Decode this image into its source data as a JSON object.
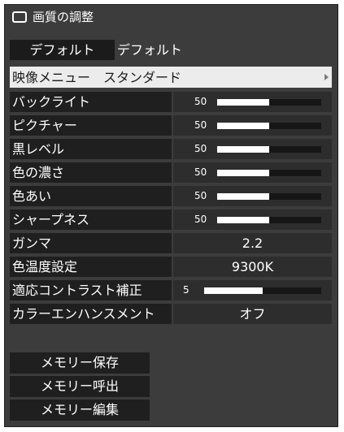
{
  "title": "画質の調整",
  "default": {
    "button": "デフォルト",
    "value": "デフォルト"
  },
  "menu": {
    "label": "映像メニュー",
    "value": "スタンダード"
  },
  "sliders": [
    {
      "label": "バックライト",
      "value": "50",
      "fraction": 0.5
    },
    {
      "label": "ピクチャー",
      "value": "50",
      "fraction": 0.5
    },
    {
      "label": "黒レベル",
      "value": "50",
      "fraction": 0.5
    },
    {
      "label": "色の濃さ",
      "value": "50",
      "fraction": 0.5
    },
    {
      "label": "色あい",
      "value": "50",
      "fraction": 0.5
    },
    {
      "label": "シャープネス",
      "value": "50",
      "fraction": 0.5
    }
  ],
  "gamma": {
    "label": "ガンマ",
    "value": "2.2"
  },
  "color_temp": {
    "label": "色温度設定",
    "value": "9300K"
  },
  "adaptive_contrast": {
    "label": "適応コントラスト補正",
    "value": "5",
    "fraction": 0.5
  },
  "color_enhance": {
    "label": "カラーエンハンスメント",
    "value": "オフ"
  },
  "memory": {
    "save": "メモリー保存",
    "recall": "メモリー呼出",
    "edit": "メモリー編集"
  }
}
